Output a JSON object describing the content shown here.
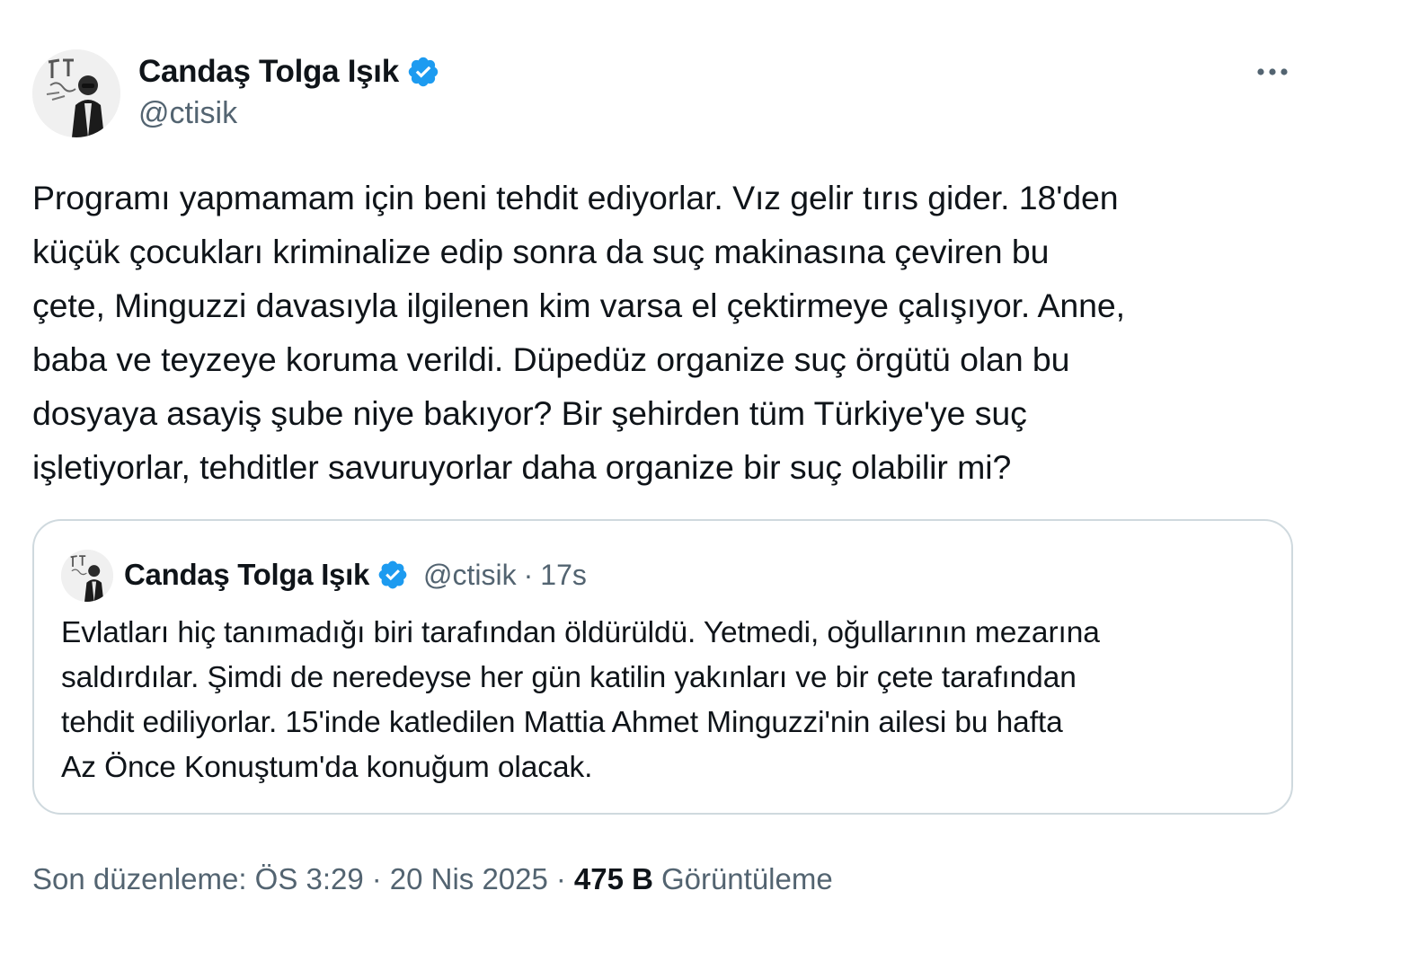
{
  "author": {
    "display_name": "Candaş Tolga Işık",
    "handle": "@ctisik",
    "avatar_icon": "avatar-photo"
  },
  "tweet": {
    "text": "Programı yapmamam için beni tehdit ediyorlar. Vız gelir tırıs gider. 18'den\nküçük çocukları kriminalize edip sonra da suç makinasına çeviren bu\nçete, Minguzzi davasıyla ilgilenen kim varsa el çektirmeye çalışıyor. Anne,\nbaba ve teyzeye koruma verildi. Düpedüz organize suç örgütü olan bu\ndosyaya asayiş şube niye bakıyor? Bir şehirden tüm Türkiye'ye suç\nişletiyorlar, tehditler savuruyorlar daha organize bir suç olabilir mi?"
  },
  "quoted_tweet": {
    "display_name": "Candaş Tolga Işık",
    "handle": "@ctisik",
    "separator": "·",
    "time": "17s",
    "text": "Evlatları hiç tanımadığı biri tarafından öldürüldü. Yetmedi, oğullarının mezarına\nsaldırdılar. Şimdi de neredeyse her gün katilin yakınları ve bir çete tarafından\ntehdit ediliyorlar. 15'inde katledilen Mattia Ahmet Minguzzi'nin ailesi bu hafta\nAz Önce Konuştum'da konuğum olacak."
  },
  "footer": {
    "edited_label": "Son düzenleme: ÖS 3:29",
    "separator": "·",
    "date": "20 Nis 2025",
    "views_count": "475 B",
    "views_label": "Görüntüleme"
  },
  "colors": {
    "verified_badge": "#1d9bf0",
    "secondary_text": "#536471",
    "primary_text": "#0f1419",
    "quote_border": "#cfd9de"
  }
}
